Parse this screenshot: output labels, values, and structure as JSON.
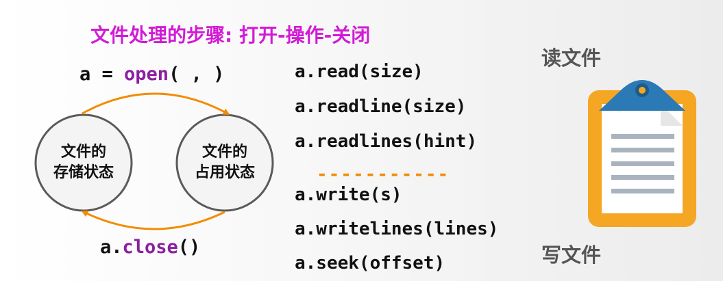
{
  "title": "文件处理的步骤: 打开-操作-关闭",
  "open_call": {
    "var": "a = ",
    "func": "open",
    "args": "( , )"
  },
  "close_call": {
    "obj": "a.",
    "func": "close",
    "args": "()"
  },
  "states": {
    "left": {
      "line1": "文件的",
      "line2": "存储状态"
    },
    "right": {
      "line1": "文件的",
      "line2": "占用状态"
    }
  },
  "read_methods": [
    "a.read(size)",
    "a.readline(size)",
    "a.readlines(hint)"
  ],
  "divider": "-----------",
  "write_methods": [
    "a.write(s)",
    "a.writelines(lines)",
    "a.seek(offset)"
  ],
  "side_labels": {
    "read": "读文件",
    "write": "写文件"
  },
  "colors": {
    "title": "#d21ad6",
    "function": "#8c1fa0",
    "arrow": "#f28c00",
    "divider": "#f28c00",
    "clipboard_board": "#f5a623",
    "clip": "#2b7ab5"
  },
  "icons": {
    "clipboard": "clipboard-icon"
  }
}
